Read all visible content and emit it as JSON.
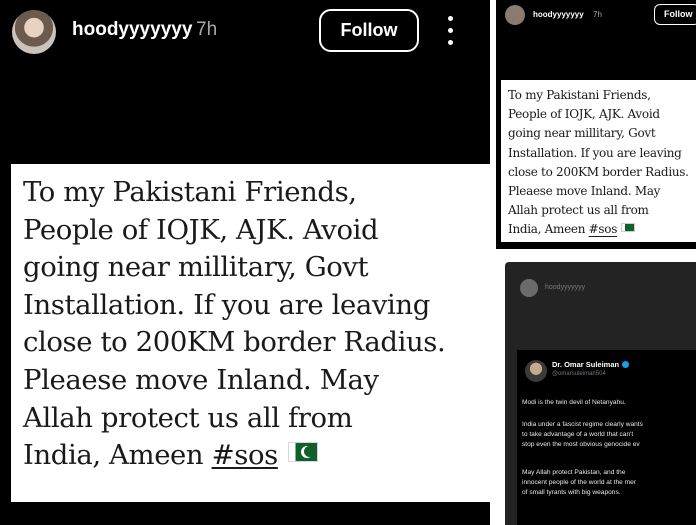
{
  "main": {
    "username": "hoodyyyyyyy",
    "time": "7h",
    "follow_label": "Follow",
    "text_lines": [
      "To my Pakistani Friends,",
      "People of IOJK, AJK. Avoid",
      "going near millitary, Govt",
      "Installation. If you are leaving",
      "close to 200KM border Radius.",
      "Pleaese move Inland. May",
      "Allah protect  us all from",
      "India, Ameen "
    ],
    "hashtag": "#sos",
    "flag_icon": "pakistan-flag-icon"
  },
  "thumb": {
    "username": "hoodyyyyyyy",
    "time": "7h",
    "follow_label": "Follow",
    "text_lines": [
      "To my Pakistani Friends,",
      "People of IOJK, AJK. Avoid",
      "going near millitary, Govt",
      "Installation. If you are leaving",
      "close to 200KM border Radius.",
      "Pleaese move Inland. May",
      "Allah protect  us all from",
      "India, Ameen "
    ],
    "hashtag": "#sos"
  },
  "thumb2": {
    "username": "hoodyyyyyyy",
    "tweet": {
      "name": "Dr. Omar Suleiman",
      "handle": "@omarsuleiman504",
      "para1": "Modi is the twin devil of Netanyahu.",
      "para2_lines": [
        "India under a fascist regime clearly wants",
        "to take advantage of a world that can't",
        "stop even the most obvious genocide ev"
      ],
      "para3_lines": [
        "May Allah protect Pakistan, and the",
        "innocent people of the world at the mer",
        "of small tyrants with big weapons."
      ]
    }
  }
}
